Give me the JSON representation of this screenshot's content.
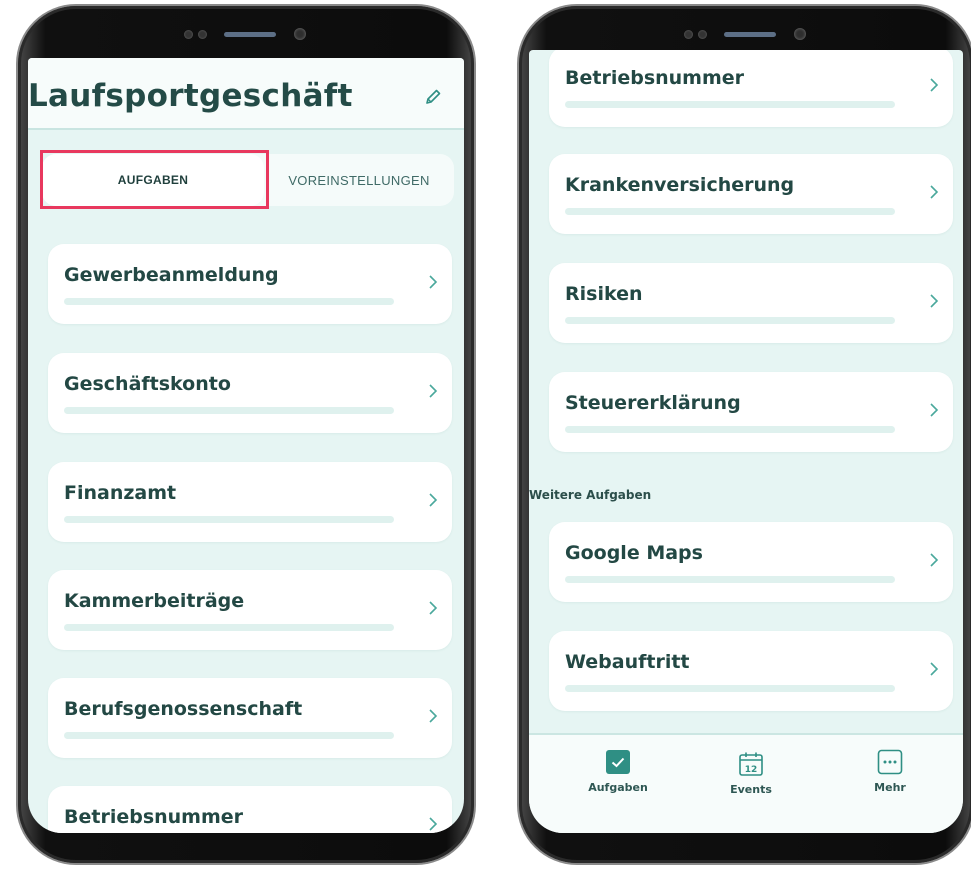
{
  "left_screen": {
    "title": "Laufsportgeschäft",
    "tabs": [
      {
        "label": "AUFGABEN",
        "active": true
      },
      {
        "label": "VOREINSTELLUNGEN",
        "active": false
      }
    ],
    "tasks": [
      {
        "label": "Gewerbeanmeldung",
        "progress": 0
      },
      {
        "label": "Geschäftskonto",
        "progress": 0
      },
      {
        "label": "Finanzamt",
        "progress": 0
      },
      {
        "label": "Kammerbeiträge",
        "progress": 0
      },
      {
        "label": "Berufsgenossenschaft",
        "progress": 0
      },
      {
        "label": "Betriebsnummer",
        "progress": 0
      }
    ]
  },
  "right_screen": {
    "tasks": [
      {
        "label": "Betriebsnummer",
        "progress": 0
      },
      {
        "label": "Krankenversicherung",
        "progress": 0
      },
      {
        "label": "Risiken",
        "progress": 0
      },
      {
        "label": "Steuererklärung",
        "progress": 0
      }
    ],
    "further_section_label": "Weitere Aufgaben",
    "further_tasks": [
      {
        "label": "Google Maps",
        "progress": 0
      },
      {
        "label": "Webauftritt",
        "progress": 0
      }
    ],
    "bottom_nav": [
      {
        "label": "Aufgaben",
        "icon": "checkbox-icon",
        "calendar_day": ""
      },
      {
        "label": "Events",
        "icon": "calendar-icon",
        "calendar_day": "12"
      },
      {
        "label": "Mehr",
        "icon": "more-icon",
        "calendar_day": ""
      }
    ]
  },
  "colors": {
    "accent": "#2f8f84",
    "screen_background": "#e6f5f3",
    "highlight": "#e8385e",
    "text_dark": "#234844"
  }
}
